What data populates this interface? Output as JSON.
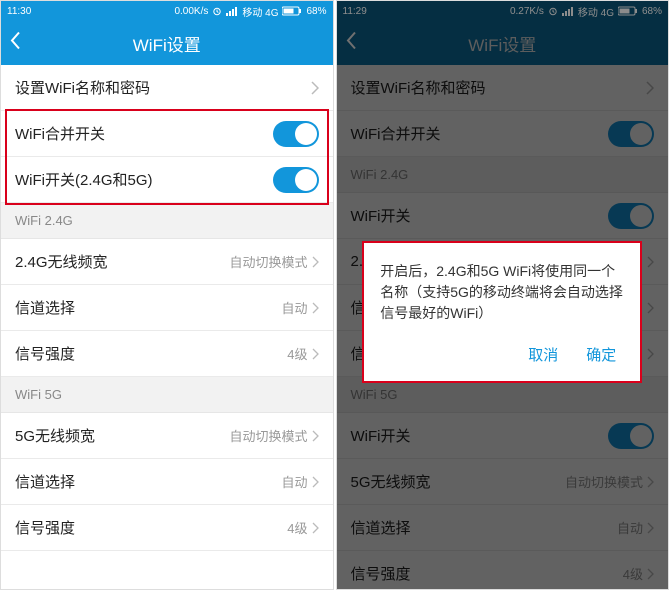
{
  "left": {
    "status": {
      "time": "11:30",
      "speed": "0.00K/s",
      "net": "移动 4G",
      "battery": "68%"
    },
    "header": {
      "title": "WiFi设置"
    },
    "rows": {
      "set_name_pw": "设置WiFi名称和密码",
      "merge_switch": "WiFi合并开关",
      "wifi_switch_both": "WiFi开关(2.4G和5G)",
      "section_24": "WiFi 2.4G",
      "bw_24_label": "2.4G无线频宽",
      "bw_24_value": "自动切换模式",
      "ch_label": "信道选择",
      "ch_value": "自动",
      "sig_label": "信号强度",
      "sig_value": "4级",
      "section_5g": "WiFi 5G",
      "bw_5_label": "5G无线频宽",
      "bw_5_value": "自动切换模式",
      "ch5_label": "信道选择",
      "ch5_value": "自动",
      "sig5_label": "信号强度",
      "sig5_value": "4级"
    }
  },
  "right": {
    "status": {
      "time": "11:29",
      "speed": "0.27K/s",
      "net": "移动 4G",
      "battery": "68%"
    },
    "header": {
      "title": "WiFi设置"
    },
    "rows": {
      "set_name_pw": "设置WiFi名称和密码",
      "merge_switch": "WiFi合并开关",
      "section_24": "WiFi 2.4G",
      "wifi_switch_24": "WiFi开关",
      "bw_24_label": "2.4",
      "ch_label": "信",
      "sig_label": "信",
      "section_5g": "WiFi 5G",
      "wifi_switch_5": "WiFi开关",
      "bw_5_label": "5G无线频宽",
      "bw_5_value": "自动切换模式",
      "ch5_label": "信道选择",
      "ch5_value": "自动",
      "sig5_label": "信号强度",
      "sig5_value": "4级"
    },
    "dialog": {
      "text": "开启后，2.4G和5G WiFi将使用同一个名称（支持5G的移动终端将会自动选择信号最好的WiFi）",
      "cancel": "取消",
      "ok": "确定"
    }
  }
}
